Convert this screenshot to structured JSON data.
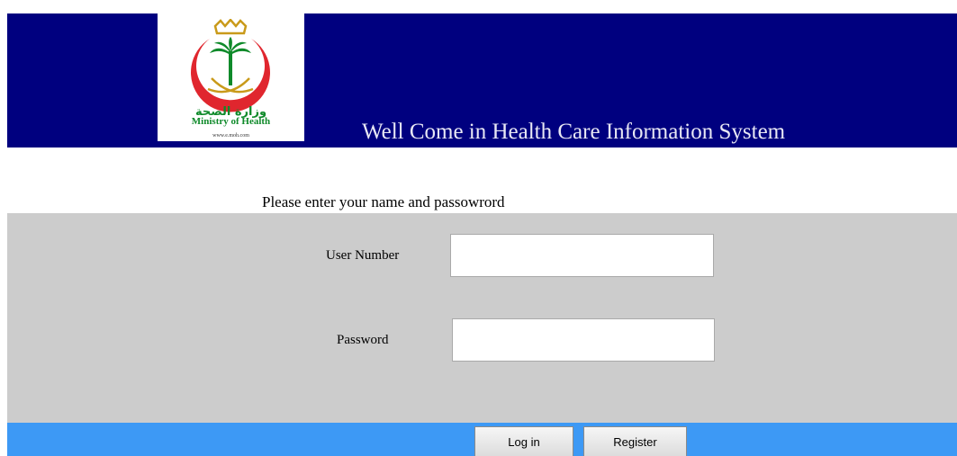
{
  "header": {
    "welcome_text": "Well Come in Health Care Information System",
    "background_color": "#00007f",
    "logo": {
      "arabic_text": "وزارة الصحة",
      "english_text": "Ministry of Health",
      "url_text": "www.e.moh.com",
      "brand_color": "#0f8a2a",
      "accent_color": "#e0262e",
      "gold_color": "#c99a1a"
    }
  },
  "login": {
    "prompt": "Please enter your name and passowrord",
    "panel_color": "#cccccc",
    "user_label": "User Number",
    "user_value": "",
    "password_label": "Password",
    "password_value": ""
  },
  "actions": {
    "bar_color": "#3d99f5",
    "login_label": "Log in",
    "register_label": "Register"
  }
}
